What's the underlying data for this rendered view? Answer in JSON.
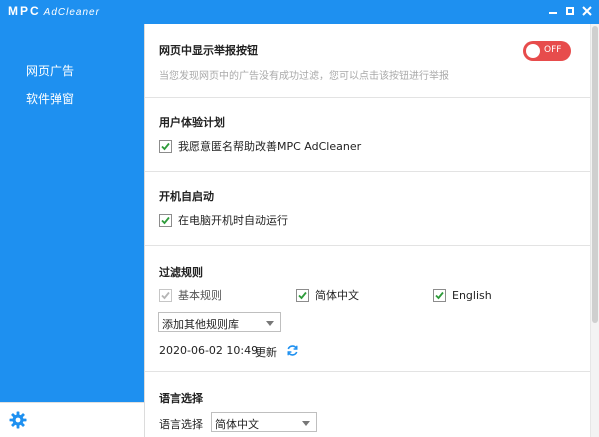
{
  "app": {
    "logo_brand": "MPC",
    "logo_product": "AdCleaner"
  },
  "window": {
    "min_glyph": "",
    "close_glyph": "✕"
  },
  "sidebar": {
    "items": [
      {
        "label": "网页广告"
      },
      {
        "label": "软件弹窗"
      }
    ],
    "settings_icon": "gear-icon"
  },
  "sections": {
    "report_button": {
      "title": "网页中显示举报按钮",
      "description": "当您发现网页中的广告没有成功过滤，您可以点击该按钮进行举报",
      "toggle_label": "OFF",
      "toggle_state": "off"
    },
    "ux_plan": {
      "title": "用户体验计划",
      "checkbox_label": "我愿意匿名帮助改善MPC AdCleaner",
      "checked": true
    },
    "autostart": {
      "title": "开机自启动",
      "checkbox_label": "在电脑开机时自动运行",
      "checked": true
    },
    "filter_rules": {
      "title": "过滤规则",
      "rules": [
        {
          "label": "基本规则",
          "checked": true,
          "disabled": true
        },
        {
          "label": "简体中文",
          "checked": true,
          "disabled": false
        },
        {
          "label": "English",
          "checked": true,
          "disabled": false
        }
      ],
      "add_rule_select": "添加其他规则库",
      "updated_at": "2020-06-02 10:49",
      "update_label": "更新"
    },
    "language": {
      "title": "语言选择",
      "label": "语言选择",
      "selected": "简体中文"
    }
  },
  "colors": {
    "accent": "#1e90f0",
    "toggle_off": "#e74c4c",
    "check": "#2e9b3a"
  }
}
